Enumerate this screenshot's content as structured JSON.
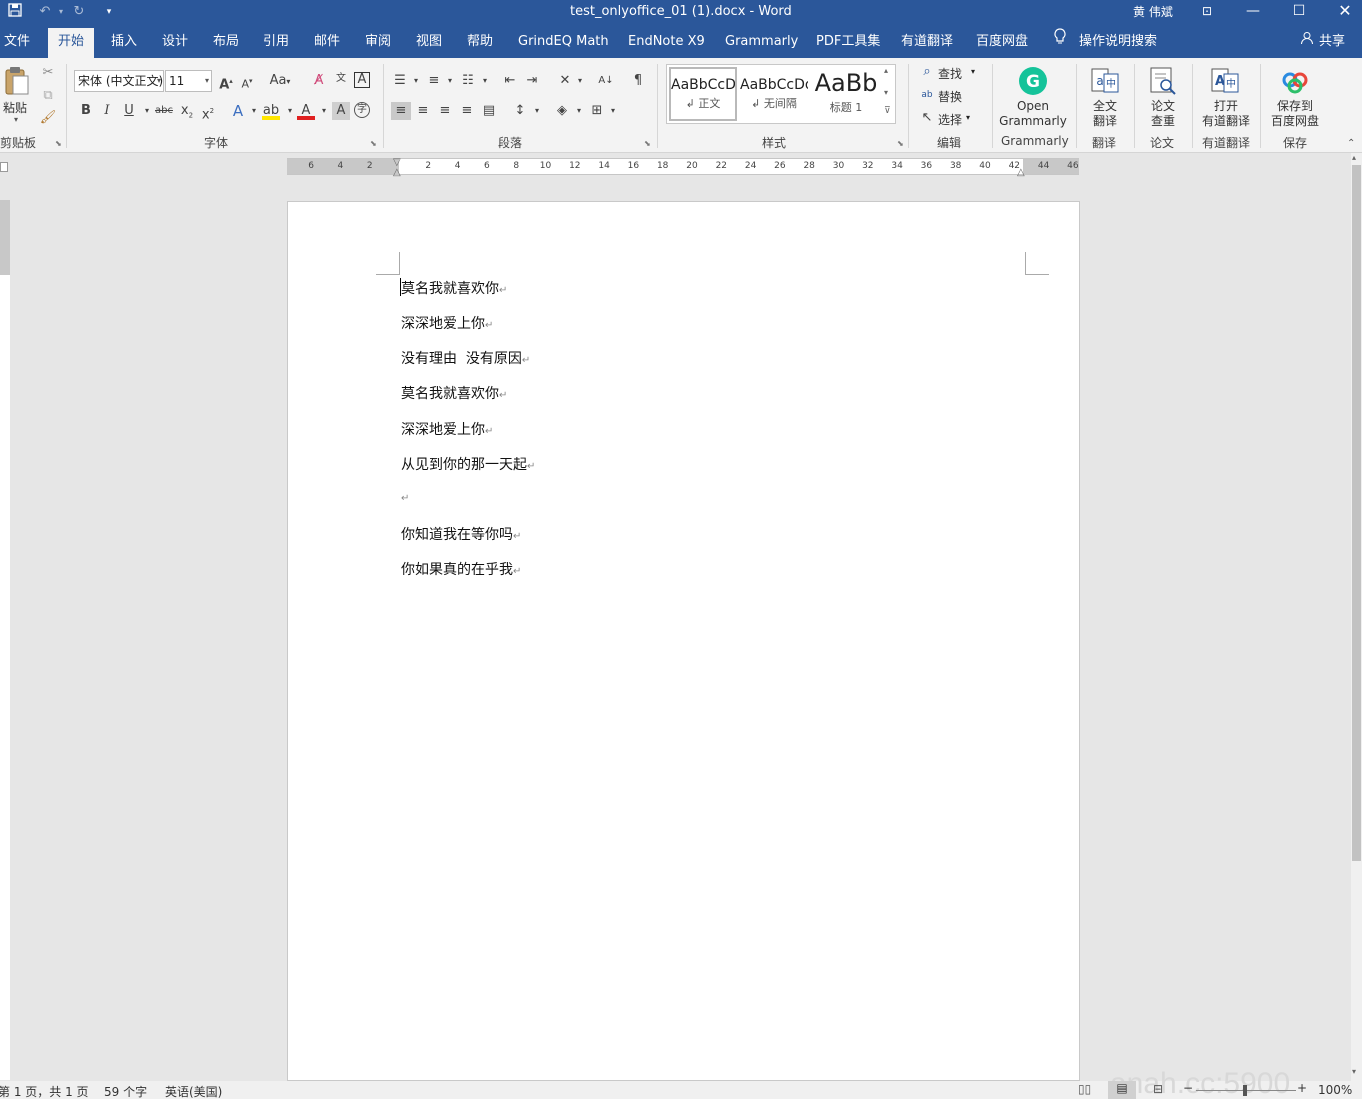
{
  "titlebar": {
    "title": "test_onlyoffice_01 (1).docx  -  Word",
    "user": "黄 伟斌",
    "icons": [
      "save-icon",
      "undo-icon",
      "redo-icon",
      "customize-qat-icon"
    ],
    "window_controls": [
      "ribbon-display-icon",
      "minimize-icon",
      "maximize-icon",
      "close-icon"
    ]
  },
  "menu": {
    "tabs": [
      "文件",
      "开始",
      "插入",
      "设计",
      "布局",
      "引用",
      "邮件",
      "审阅",
      "视图",
      "帮助",
      "GrindEQ Math",
      "EndNote X9",
      "Grammarly",
      "PDF工具集",
      "有道翻译",
      "百度网盘"
    ],
    "active": "开始",
    "tell_me": "操作说明搜索",
    "share": "共享"
  },
  "ribbon": {
    "clipboard": {
      "paste": "粘贴",
      "label": "剪贴板"
    },
    "font": {
      "name": "宋体 (中文正文)",
      "size": "11",
      "label": "字体",
      "case_btn": "Aa"
    },
    "paragraph": {
      "label": "段落"
    },
    "styles": {
      "label": "样式",
      "items": [
        {
          "preview": "AaBbCcDd",
          "name": "正文"
        },
        {
          "preview": "AaBbCcDd",
          "name": "无间隔"
        },
        {
          "preview": "AaBb",
          "name": "标题 1"
        }
      ]
    },
    "editing": {
      "label": "编辑",
      "find": "查找",
      "replace": "替换",
      "select": "选择"
    },
    "grammarly": {
      "line1": "Open",
      "line2": "Grammarly",
      "label": "Grammarly"
    },
    "translate": {
      "line1": "全文",
      "line2": "翻译",
      "label": "翻译"
    },
    "paper": {
      "line1": "论文",
      "line2": "查重",
      "label": "论文"
    },
    "youdao": {
      "line1": "打开",
      "line2": "有道翻译",
      "label": "有道翻译"
    },
    "save": {
      "line1": "保存到",
      "line2": "百度网盘",
      "label": "保存"
    }
  },
  "ruler": {
    "ticks": [
      "6",
      "4",
      "2",
      "2",
      "4",
      "6",
      "8",
      "10",
      "12",
      "14",
      "16",
      "18",
      "20",
      "22",
      "24",
      "26",
      "28",
      "30",
      "32",
      "34",
      "36",
      "38",
      "40",
      "42",
      "44",
      "46"
    ]
  },
  "document": {
    "lines": [
      "莫名我就喜欢你",
      "深深地爱上你",
      "没有理由  没有原因",
      "莫名我就喜欢你",
      "深深地爱上你",
      "从见到你的那一天起",
      "",
      "你知道我在等你吗",
      "你如果真的在乎我"
    ]
  },
  "status": {
    "page": "第 1 页，共 1 页",
    "words": "59 个字",
    "lang": "英语(美国)",
    "zoom": "100%",
    "watermark": "anah.cc:5900"
  }
}
